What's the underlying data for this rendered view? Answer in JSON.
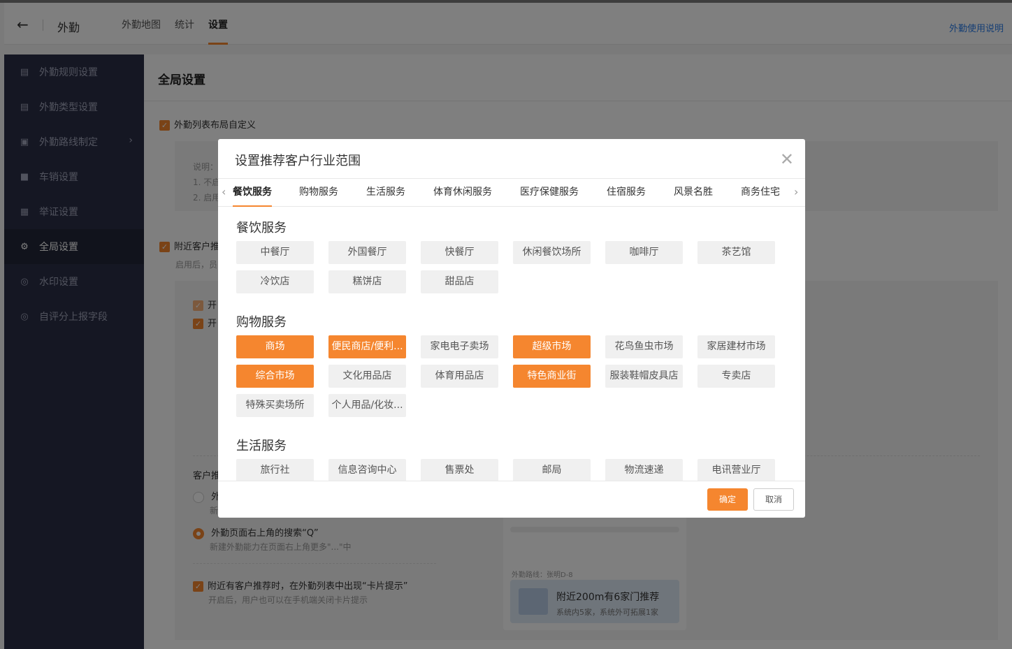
{
  "header": {
    "back_icon": "arrow-left-icon",
    "app_title": "外勤",
    "tabs": [
      {
        "label": "外勤地图"
      },
      {
        "label": "统计"
      },
      {
        "label": "设置"
      }
    ],
    "active_tab": "设置",
    "help_link": "外勤使用说明"
  },
  "sidebar": {
    "items": [
      {
        "label": "外勤规则设置",
        "icon": "list-doc-icon"
      },
      {
        "label": "外勤类型设置",
        "icon": "doc-icon"
      },
      {
        "label": "外勤路线制定",
        "icon": "route-icon"
      },
      {
        "label": "车销设置",
        "icon": "truck-icon"
      },
      {
        "label": "举证设置",
        "icon": "evidence-icon"
      },
      {
        "label": "全局设置",
        "icon": "gear-icon"
      },
      {
        "label": "水印设置",
        "icon": "watermark-icon"
      },
      {
        "label": "自评分上报字段",
        "icon": "score-icon"
      }
    ],
    "active": "全局设置"
  },
  "main": {
    "section_title": "全局设置",
    "option1": "外勤列表布局自定义",
    "desc_label": "说明：",
    "desc_line1": "1. 不启",
    "desc_line2": "2. 启用",
    "option2": "附近客户推",
    "option2_desc": "启用后，员",
    "sub1": "开",
    "sub2": "开",
    "cust_label": "客户推",
    "radio1": "外",
    "radio1_desc": "新",
    "radio2": "外勤页面右上角的搜索“Q”",
    "radio2_desc": "新建外勤能力在页面右上角更多\"...\"中",
    "option3": "附近有客户推荐时，在外勤列表中出现“卡片提示”",
    "option3_desc": "开启后，用户也可以在手机端关闭卡片提示",
    "preview": {
      "route": "外勤路线：张明D-8",
      "title": "附近200m有6家门推荐",
      "subtitle": "系统内5家，系统外可拓展1家"
    }
  },
  "modal": {
    "title": "设置推荐客户行业范围",
    "tabs": [
      "餐饮服务",
      "购物服务",
      "生活服务",
      "体育休闲服务",
      "医疗保健服务",
      "住宿服务",
      "风景名胜",
      "商务住宅"
    ],
    "active_tab": "餐饮服务",
    "groups": [
      {
        "title": "餐饮服务",
        "items": [
          {
            "label": "中餐厅",
            "selected": false
          },
          {
            "label": "外国餐厅",
            "selected": false
          },
          {
            "label": "快餐厅",
            "selected": false
          },
          {
            "label": "休闲餐饮场所",
            "selected": false
          },
          {
            "label": "咖啡厅",
            "selected": false
          },
          {
            "label": "茶艺馆",
            "selected": false
          },
          {
            "label": "冷饮店",
            "selected": false
          },
          {
            "label": "糕饼店",
            "selected": false
          },
          {
            "label": "甜品店",
            "selected": false
          }
        ]
      },
      {
        "title": "购物服务",
        "items": [
          {
            "label": "商场",
            "selected": true
          },
          {
            "label": "便民商店/便利...",
            "selected": true
          },
          {
            "label": "家电电子卖场",
            "selected": false
          },
          {
            "label": "超级市场",
            "selected": true
          },
          {
            "label": "花鸟鱼虫市场",
            "selected": false
          },
          {
            "label": "家居建材市场",
            "selected": false
          },
          {
            "label": "综合市场",
            "selected": true
          },
          {
            "label": "文化用品店",
            "selected": false
          },
          {
            "label": "体育用品店",
            "selected": false
          },
          {
            "label": "特色商业街",
            "selected": true
          },
          {
            "label": "服装鞋帽皮具店",
            "selected": false
          },
          {
            "label": "专卖店",
            "selected": false
          },
          {
            "label": "特殊买卖场所",
            "selected": false
          },
          {
            "label": "个人用品/化妆...",
            "selected": false
          }
        ]
      },
      {
        "title": "生活服务",
        "items": [
          {
            "label": "旅行社",
            "selected": false
          },
          {
            "label": "信息咨询中心",
            "selected": false
          },
          {
            "label": "售票处",
            "selected": false
          },
          {
            "label": "邮局",
            "selected": false
          },
          {
            "label": "物流速递",
            "selected": false
          },
          {
            "label": "电讯营业厅",
            "selected": false
          }
        ]
      }
    ],
    "confirm_label": "确定",
    "cancel_label": "取消",
    "accent": "#f5862f"
  }
}
